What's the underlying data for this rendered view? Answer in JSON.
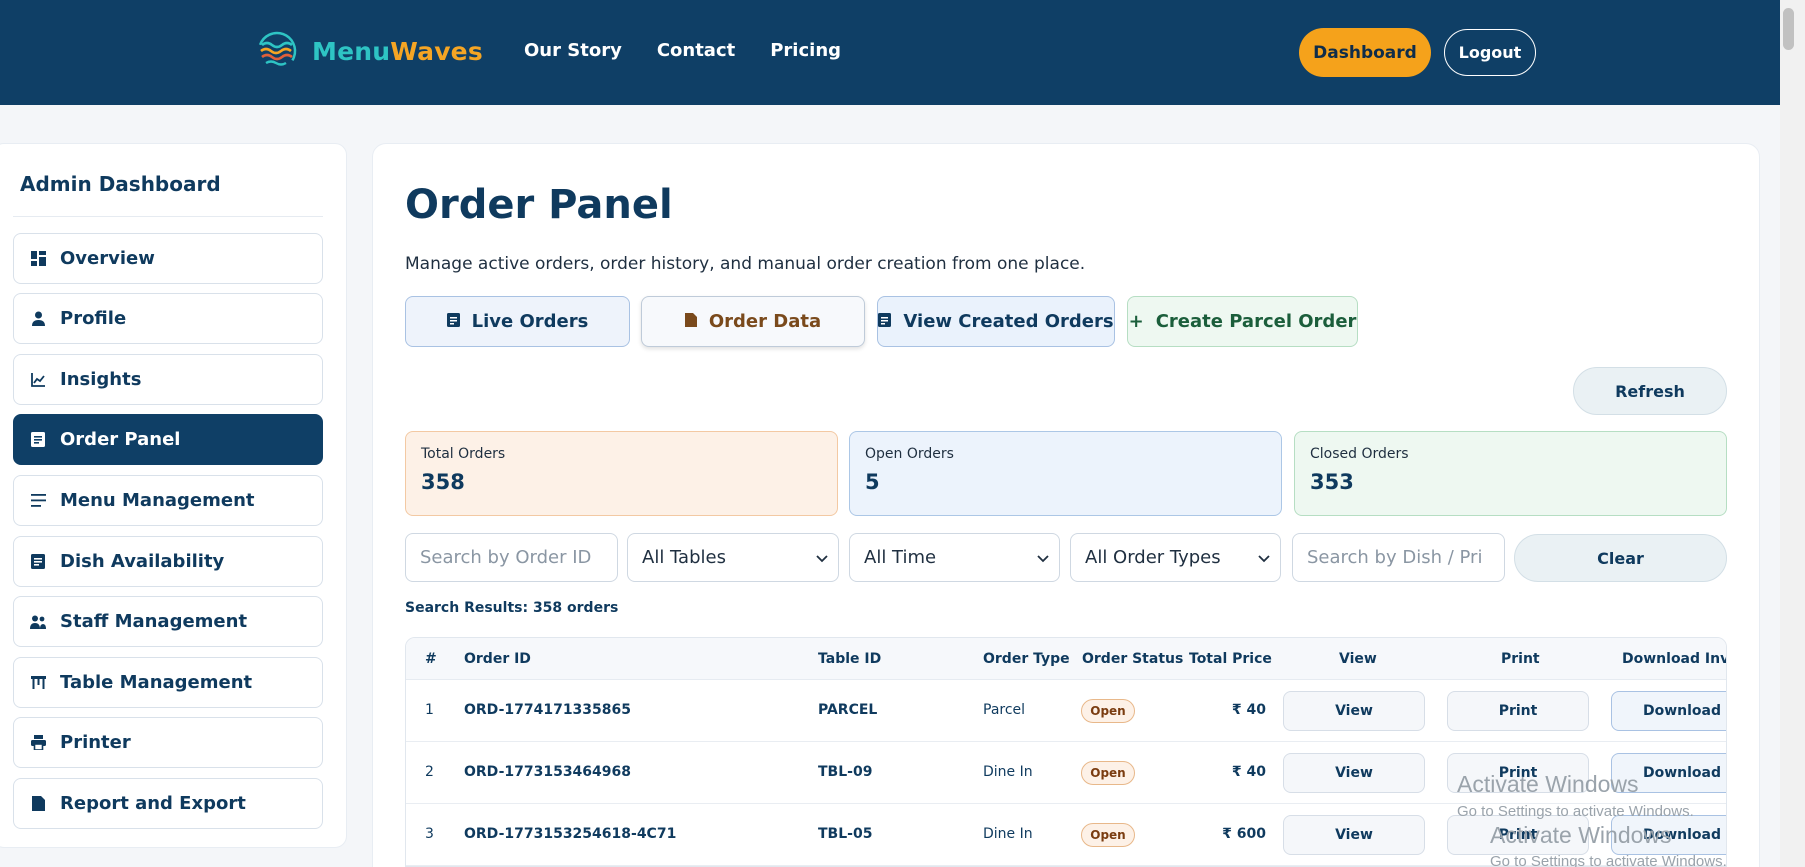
{
  "header": {
    "logo_part1": "Menu",
    "logo_part2": "Waves",
    "nav": [
      "Our Story",
      "Contact",
      "Pricing"
    ],
    "dashboard_label": "Dashboard",
    "logout_label": "Logout"
  },
  "sidebar": {
    "title": "Admin Dashboard",
    "items": [
      {
        "label": "Overview",
        "icon": "dashboard-icon"
      },
      {
        "label": "Profile",
        "icon": "person-icon"
      },
      {
        "label": "Insights",
        "icon": "chart-icon"
      },
      {
        "label": "Order Panel",
        "icon": "receipt-icon",
        "active": true
      },
      {
        "label": "Menu Management",
        "icon": "menu-lines-icon"
      },
      {
        "label": "Dish Availability",
        "icon": "receipt-icon"
      },
      {
        "label": "Staff Management",
        "icon": "people-icon"
      },
      {
        "label": "Table Management",
        "icon": "table-icon"
      },
      {
        "label": "Printer",
        "icon": "printer-icon"
      },
      {
        "label": "Report and Export",
        "icon": "file-icon"
      }
    ]
  },
  "main": {
    "title": "Order Panel",
    "description": "Manage active orders, order history, and manual order creation from one place.",
    "tabs": {
      "live": "Live Orders",
      "data": "Order Data",
      "view": "View Created Orders",
      "create": "Create Parcel Order"
    },
    "refresh_label": "Refresh",
    "stats": {
      "total_label": "Total Orders",
      "total_value": "358",
      "open_label": "Open Orders",
      "open_value": "5",
      "closed_label": "Closed Orders",
      "closed_value": "353"
    },
    "filters": {
      "order_placeholder": "Search by Order ID",
      "table_value": "All Tables",
      "time_value": "All Time",
      "type_value": "All Order Types",
      "dish_placeholder": "Search by Dish / Pri",
      "clear_label": "Clear"
    },
    "results_text": "Search Results: 358 orders",
    "table": {
      "headers": [
        "#",
        "Order ID",
        "Table ID",
        "Order Type",
        "Order Status",
        "Total Price",
        "View",
        "Print",
        "Download Invoi"
      ],
      "rows": [
        {
          "n": "1",
          "order_id": "ORD-1774171335865",
          "table_id": "PARCEL",
          "type": "Parcel",
          "status": "Open",
          "price": "₹ 40",
          "view": "View",
          "print": "Print",
          "download": "Download"
        },
        {
          "n": "2",
          "order_id": "ORD-1773153464968",
          "table_id": "TBL-09",
          "type": "Dine In",
          "status": "Open",
          "price": "₹ 40",
          "view": "View",
          "print": "Print",
          "download": "Download"
        },
        {
          "n": "3",
          "order_id": "ORD-1773153254618-4C71",
          "table_id": "TBL-05",
          "type": "Dine In",
          "status": "Open",
          "price": "₹ 600",
          "view": "View",
          "print": "Print",
          "download": "Download"
        }
      ]
    }
  },
  "watermark": {
    "line1": "Activate Windows",
    "line2": "Go to Settings to activate Windows.",
    "line3": "Activate Windows",
    "line4": "Go to Settings to activate Windows."
  }
}
